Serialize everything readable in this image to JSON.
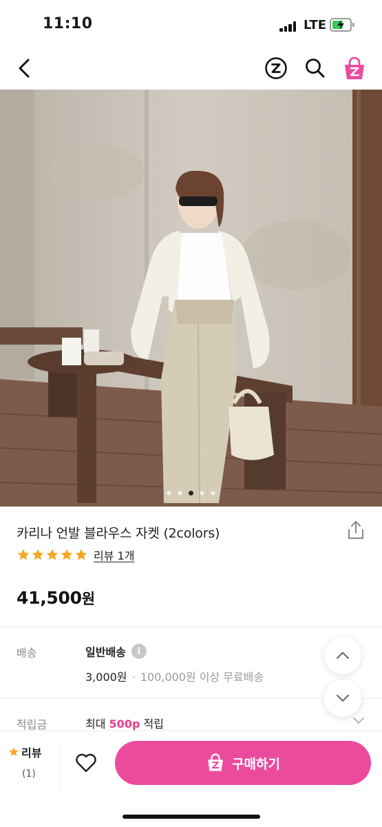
{
  "status_bar": {
    "time": "11:10",
    "network": "LTE"
  },
  "nav": {
    "back_icon": "chevron-left-icon",
    "z_icon": "zigzag-z-icon",
    "search_icon": "search-icon",
    "cart_icon": "cart-z-icon"
  },
  "gallery": {
    "total_images": 5,
    "active_index": 2
  },
  "product": {
    "title": "카리나 언발 블라우스 자켓 (2colors)",
    "rating_stars": 5,
    "review_link": "리뷰 1개",
    "price": "41,500",
    "price_unit": "원"
  },
  "shipping": {
    "label": "배송",
    "method": "일반배송",
    "fee": "3,000원",
    "separator": "·",
    "free_condition": "100,000원 이상 무료배송"
  },
  "points": {
    "label": "적립금",
    "prefix": "최대",
    "amount": "500p",
    "suffix": "적립"
  },
  "bottom_bar": {
    "review_label": "리뷰",
    "review_count": "(1)",
    "buy_label": "구매하기"
  },
  "colors": {
    "accent": "#eb4b9d",
    "star": "#f5a623",
    "points": "#e83e8c"
  }
}
